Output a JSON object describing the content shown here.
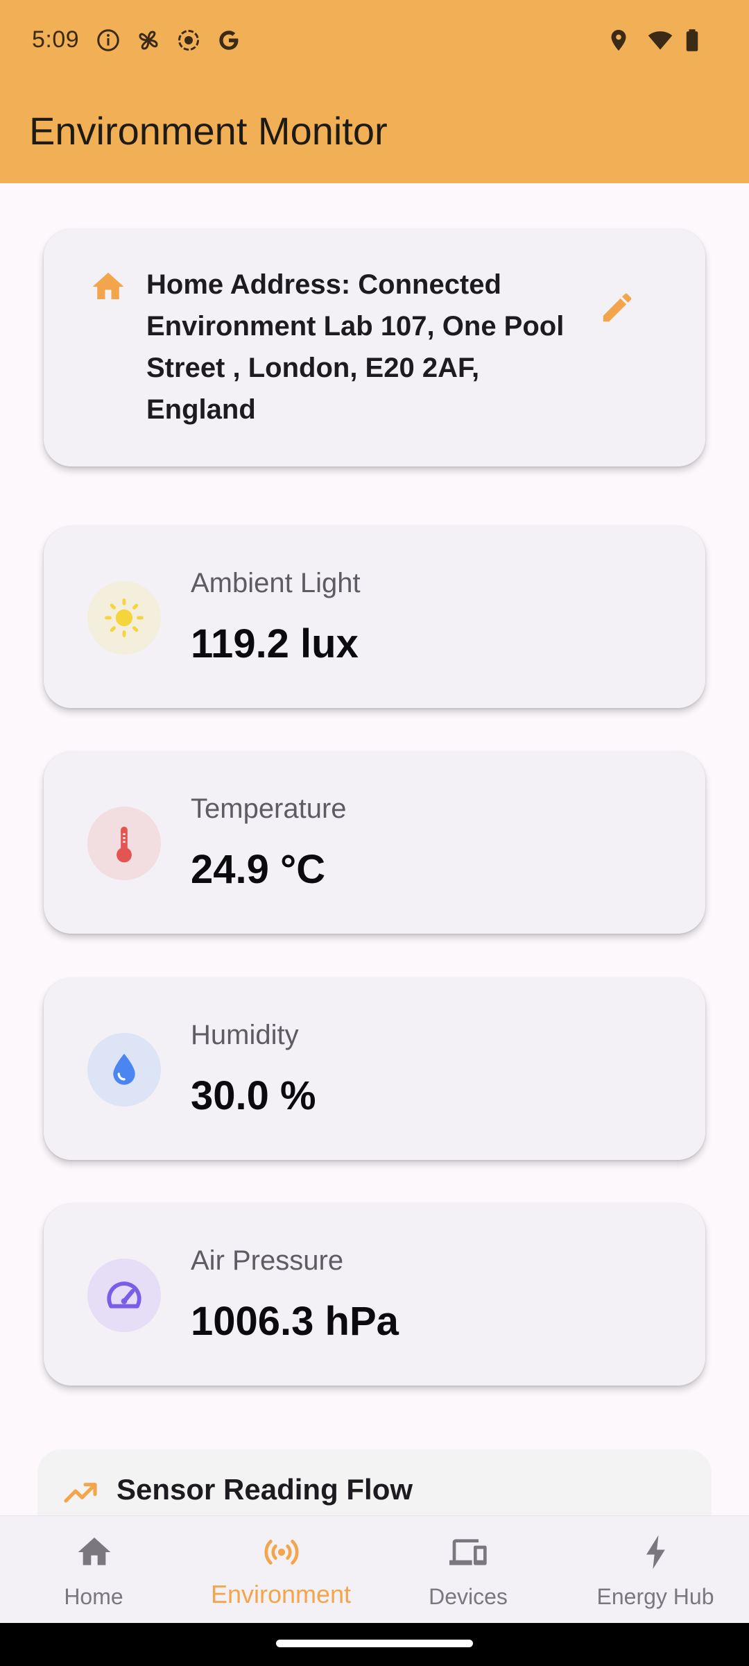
{
  "status_bar": {
    "time": "5:09",
    "icons": [
      "info-icon",
      "fan-icon",
      "record-icon",
      "google-icon",
      "location-icon",
      "wifi-icon",
      "battery-icon"
    ]
  },
  "app_bar": {
    "title": "Environment Monitor",
    "color": "#f2b056"
  },
  "address": {
    "text": "Home Address: Connected Environment Lab 107, One Pool Street , London, E20 2AF, England",
    "icon": "home-icon",
    "edit_icon": "pencil-icon"
  },
  "sensors": [
    {
      "label": "Ambient Light",
      "value": "119.2 lux",
      "icon": "sun-icon",
      "icon_color": "#f6d43c",
      "bg": "#f4eedc"
    },
    {
      "label": "Temperature",
      "value": "24.9 °C",
      "icon": "thermometer-icon",
      "icon_color": "#e35552",
      "bg": "#f2dde1"
    },
    {
      "label": "Humidity",
      "value": "30.0 %",
      "icon": "water-drop-icon",
      "icon_color": "#4b85f2",
      "bg": "#dde4f6"
    },
    {
      "label": "Air Pressure",
      "value": "1006.3 hPa",
      "icon": "speedometer-icon",
      "icon_color": "#7a5de8",
      "bg": "#e6def6"
    }
  ],
  "flow_section": {
    "title": "Sensor Reading Flow",
    "icon": "trending-up-icon"
  },
  "bottom_nav": {
    "active_color": "#f2a54a",
    "inactive_color": "#7b777f",
    "items": [
      {
        "label": "Home",
        "icon": "home-icon",
        "active": false
      },
      {
        "label": "Environment",
        "icon": "broadcast-icon",
        "active": true
      },
      {
        "label": "Devices",
        "icon": "devices-icon",
        "active": false
      },
      {
        "label": "Energy Hub",
        "icon": "lightning-icon",
        "active": false
      }
    ]
  }
}
